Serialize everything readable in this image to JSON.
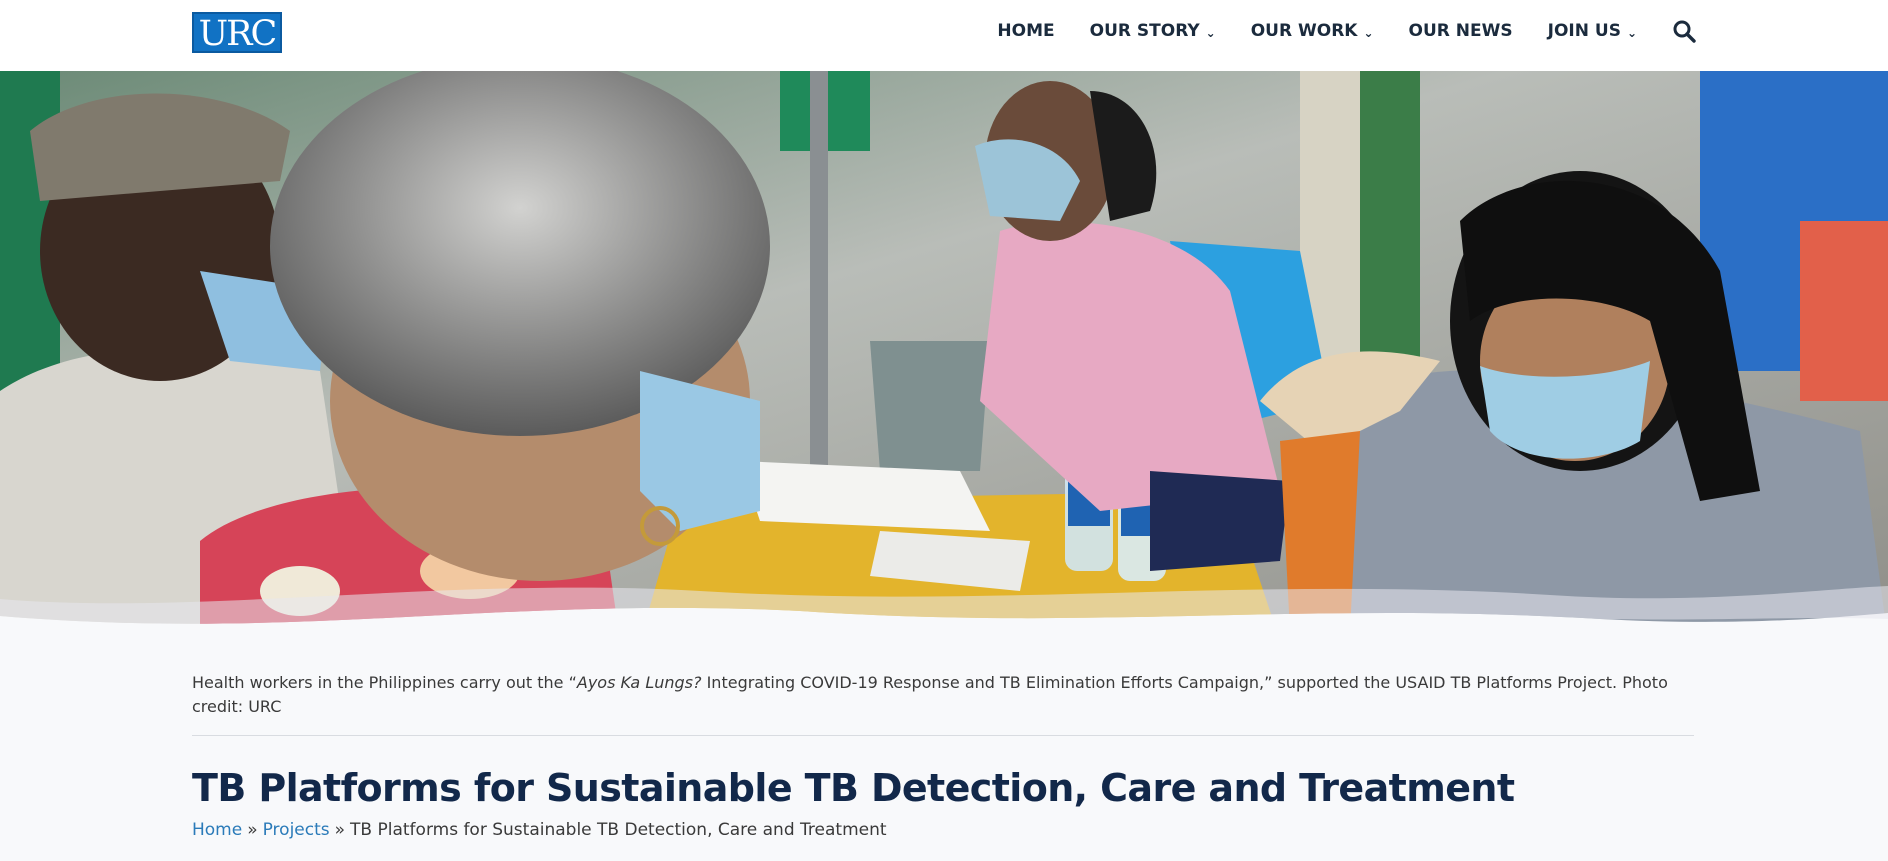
{
  "header": {
    "logo_text": "URC",
    "nav": [
      {
        "label": "HOME",
        "has_dropdown": false
      },
      {
        "label": "OUR STORY",
        "has_dropdown": true
      },
      {
        "label": "OUR WORK",
        "has_dropdown": true
      },
      {
        "label": "OUR NEWS",
        "has_dropdown": false
      },
      {
        "label": "JOIN US",
        "has_dropdown": true
      }
    ],
    "search_icon": "search-icon",
    "chevron_glyph": "⌄"
  },
  "hero": {
    "image": "photo of health workers at a table with masks, papers and water bottles"
  },
  "caption": {
    "before": "Health workers in the Philippines carry out the “",
    "italic": "Ayos Ka Lungs?",
    "after": " Integrating COVID-19 Response and TB Elimination Efforts Campaign,” supported the USAID TB Platforms Project. Photo credit: URC"
  },
  "page": {
    "title": "TB Platforms for Sustainable TB Detection, Care and Treatment"
  },
  "breadcrumb": {
    "home": "Home",
    "projects": "Projects",
    "separator": "»",
    "current": "TB Platforms for Sustainable TB Detection, Care and Treatment"
  },
  "colors": {
    "brand_blue": "#1172c4",
    "title_navy": "#12284a",
    "link_blue": "#2b7bb9",
    "nav_text": "#1b2b3d"
  }
}
